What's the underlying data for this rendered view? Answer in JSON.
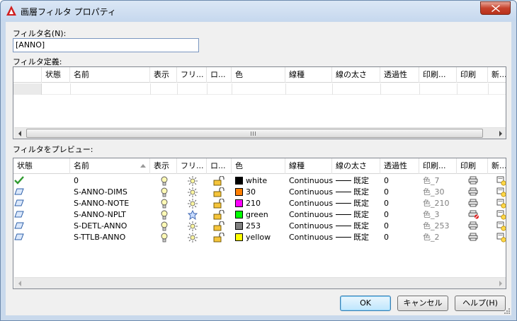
{
  "window": {
    "title": "画層フィルタ プロパティ",
    "colors": {
      "frame": "#c9d9ec",
      "close": "#c7432d"
    }
  },
  "filter_name": {
    "label": "フィルタ名(N):",
    "value": "[ANNO]"
  },
  "filter_definition": {
    "label": "フィルタ定義:",
    "columns": [
      "",
      "状態",
      "名前",
      "表示",
      "フリ...",
      "ロ...",
      "色",
      "線種",
      "線の太さ",
      "透過性",
      "印刷...",
      "印刷",
      "新..."
    ]
  },
  "preview": {
    "label": "フィルタをプレビュー:",
    "columns": [
      "状態",
      "名前",
      "表示",
      "フリ...",
      "ロ...",
      "色",
      "線種",
      "線の太さ",
      "透過性",
      "印刷...",
      "印刷",
      "新..."
    ],
    "rows": [
      {
        "status": "check-icon",
        "name": "0",
        "visible": "bulb-on-icon",
        "freeze": "sun-icon",
        "lock": "unlock-icon",
        "color_hex": "#000000",
        "color": "white",
        "linetype": "Continuous",
        "lineweight": "既定",
        "transparency": "0",
        "plot_style": "色_7",
        "plot": "printer-icon",
        "new_vp": "new-vp-freeze-icon"
      },
      {
        "status": "layer-icon",
        "name": "S-ANNO-DIMS",
        "visible": "bulb-on-icon",
        "freeze": "sun-icon",
        "lock": "unlock-icon",
        "color_hex": "#ff7f00",
        "color": "30",
        "linetype": "Continuous",
        "lineweight": "既定",
        "transparency": "0",
        "plot_style": "色_30",
        "plot": "printer-icon",
        "new_vp": "new-vp-freeze-icon"
      },
      {
        "status": "layer-icon",
        "name": "S-ANNO-NOTE",
        "visible": "bulb-on-icon",
        "freeze": "sun-icon",
        "lock": "unlock-icon",
        "color_hex": "#ff00ff",
        "color": "210",
        "linetype": "Continuous",
        "lineweight": "既定",
        "transparency": "0",
        "plot_style": "色_210",
        "plot": "printer-icon",
        "new_vp": "new-vp-freeze-icon"
      },
      {
        "status": "layer-icon",
        "name": "S-ANNO-NPLT",
        "visible": "bulb-on-icon",
        "freeze": "snowflake-icon",
        "lock": "unlock-icon",
        "color_hex": "#00ff00",
        "color": "green",
        "linetype": "Continuous",
        "lineweight": "既定",
        "transparency": "0",
        "plot_style": "色_3",
        "plot": "no-plot-icon",
        "new_vp": "new-vp-freeze-icon"
      },
      {
        "status": "layer-icon",
        "name": "S-DETL-ANNO",
        "visible": "bulb-on-icon",
        "freeze": "sun-icon",
        "lock": "unlock-icon",
        "color_hex": "#808080",
        "color": "253",
        "linetype": "Continuous",
        "lineweight": "既定",
        "transparency": "0",
        "plot_style": "色_253",
        "plot": "printer-icon",
        "new_vp": "new-vp-freeze-icon"
      },
      {
        "status": "layer-icon",
        "name": "S-TTLB-ANNO",
        "visible": "bulb-on-icon",
        "freeze": "sun-icon",
        "lock": "unlock-icon",
        "color_hex": "#ffff00",
        "color": "yellow",
        "linetype": "Continuous",
        "lineweight": "既定",
        "transparency": "0",
        "plot_style": "色_2",
        "plot": "printer-icon",
        "new_vp": "new-vp-freeze-icon"
      }
    ]
  },
  "buttons": {
    "ok": "OK",
    "cancel": "キャンセル",
    "help": "ヘルプ(H)"
  }
}
